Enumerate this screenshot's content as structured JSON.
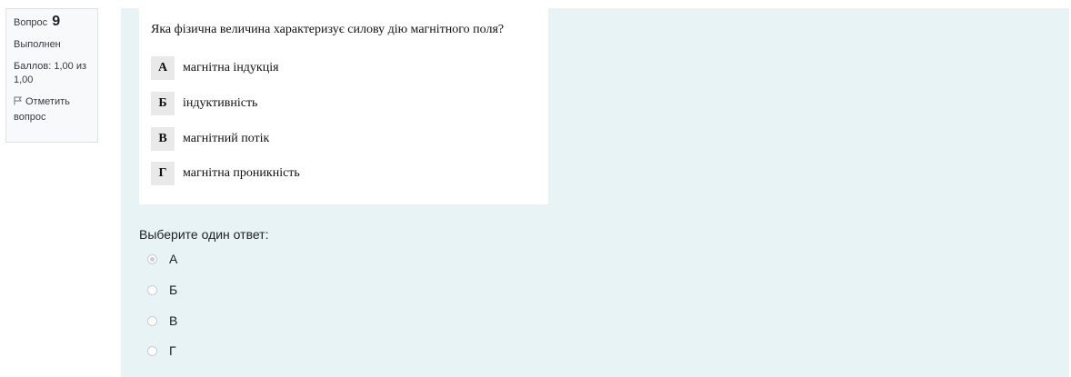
{
  "info": {
    "question_label": "Вопрос",
    "question_number": "9",
    "state": "Выполнен",
    "grade": "Баллов: 1,00 из 1,00",
    "flag_label": "Отметить вопрос"
  },
  "question_image": {
    "text": "Яка фізична величина характеризує силову дію магнітного поля?",
    "options": [
      {
        "letter": "А",
        "text": "магнітна індукція"
      },
      {
        "letter": "Б",
        "text": "індуктивність"
      },
      {
        "letter": "В",
        "text": "магнітний потік"
      },
      {
        "letter": "Г",
        "text": "магнітна проникність"
      }
    ]
  },
  "answer": {
    "prompt": "Выберите один ответ:",
    "choices": [
      {
        "label": "А",
        "selected": true
      },
      {
        "label": "Б",
        "selected": false
      },
      {
        "label": "В",
        "selected": false
      },
      {
        "label": "Г",
        "selected": false
      }
    ]
  }
}
